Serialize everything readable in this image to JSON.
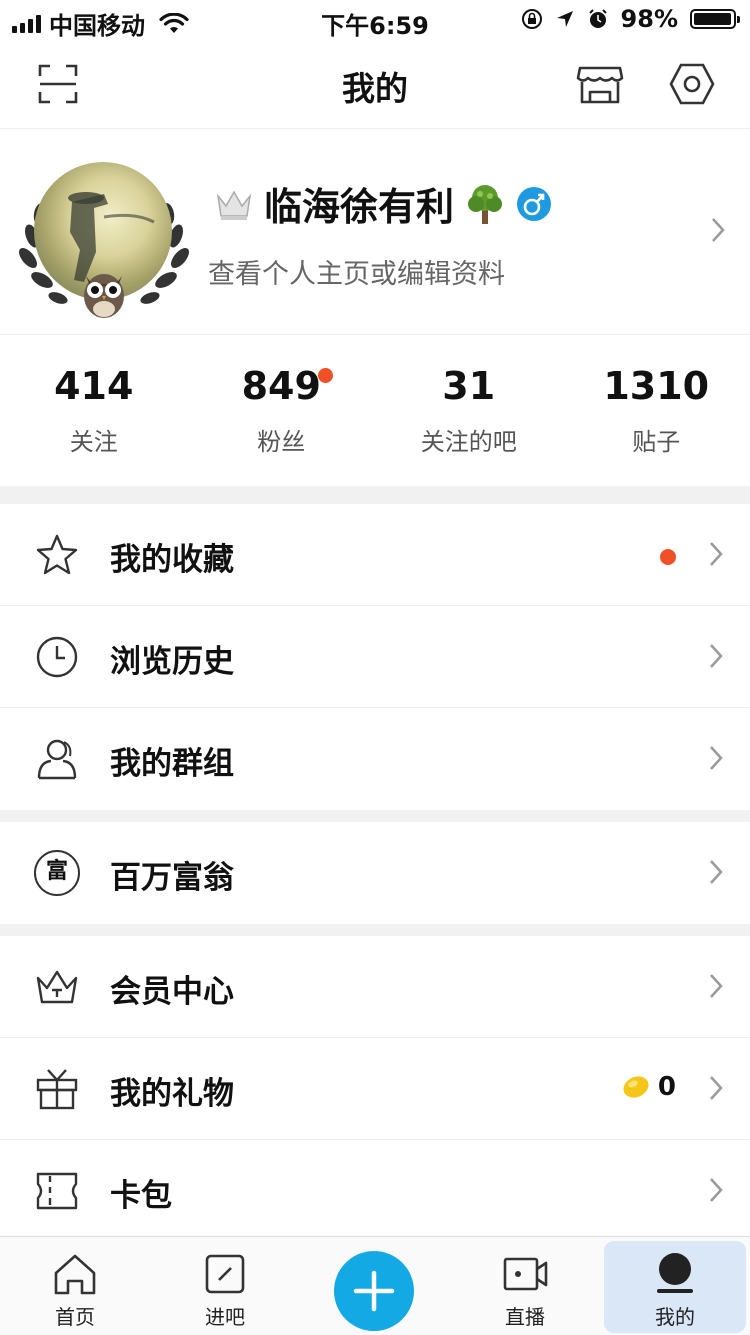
{
  "status_bar": {
    "carrier": "中国移动",
    "time": "下午6:59",
    "battery": "98%",
    "battery_level": 0.98
  },
  "nav": {
    "title": "我的",
    "icons": [
      "scan-icon",
      "shop-icon",
      "settings-icon"
    ]
  },
  "profile": {
    "name": "临海徐有利",
    "subtitle": "查看个人主页或编辑资料"
  },
  "stats": [
    {
      "value": "414",
      "label": "关注"
    },
    {
      "value": "849",
      "label": "粉丝"
    },
    {
      "value": "31",
      "label": "关注的吧"
    },
    {
      "value": "1310",
      "label": "贴子"
    }
  ],
  "menu": {
    "favorites": "我的收藏",
    "history": "浏览历史",
    "groups": "我的群组",
    "millionaire": "百万富翁",
    "millionaire_icon_char": "富",
    "vip": "会员中心",
    "gifts": "我的礼物",
    "gifts_count": "0",
    "wallet": "卡包"
  },
  "tabbar": {
    "home": "首页",
    "forum": "进吧",
    "live": "直播",
    "mine": "我的"
  },
  "colors": {
    "accent": "#12a9e5",
    "badge": "#f05025",
    "tab_active_bg": "#d9e7f7"
  }
}
